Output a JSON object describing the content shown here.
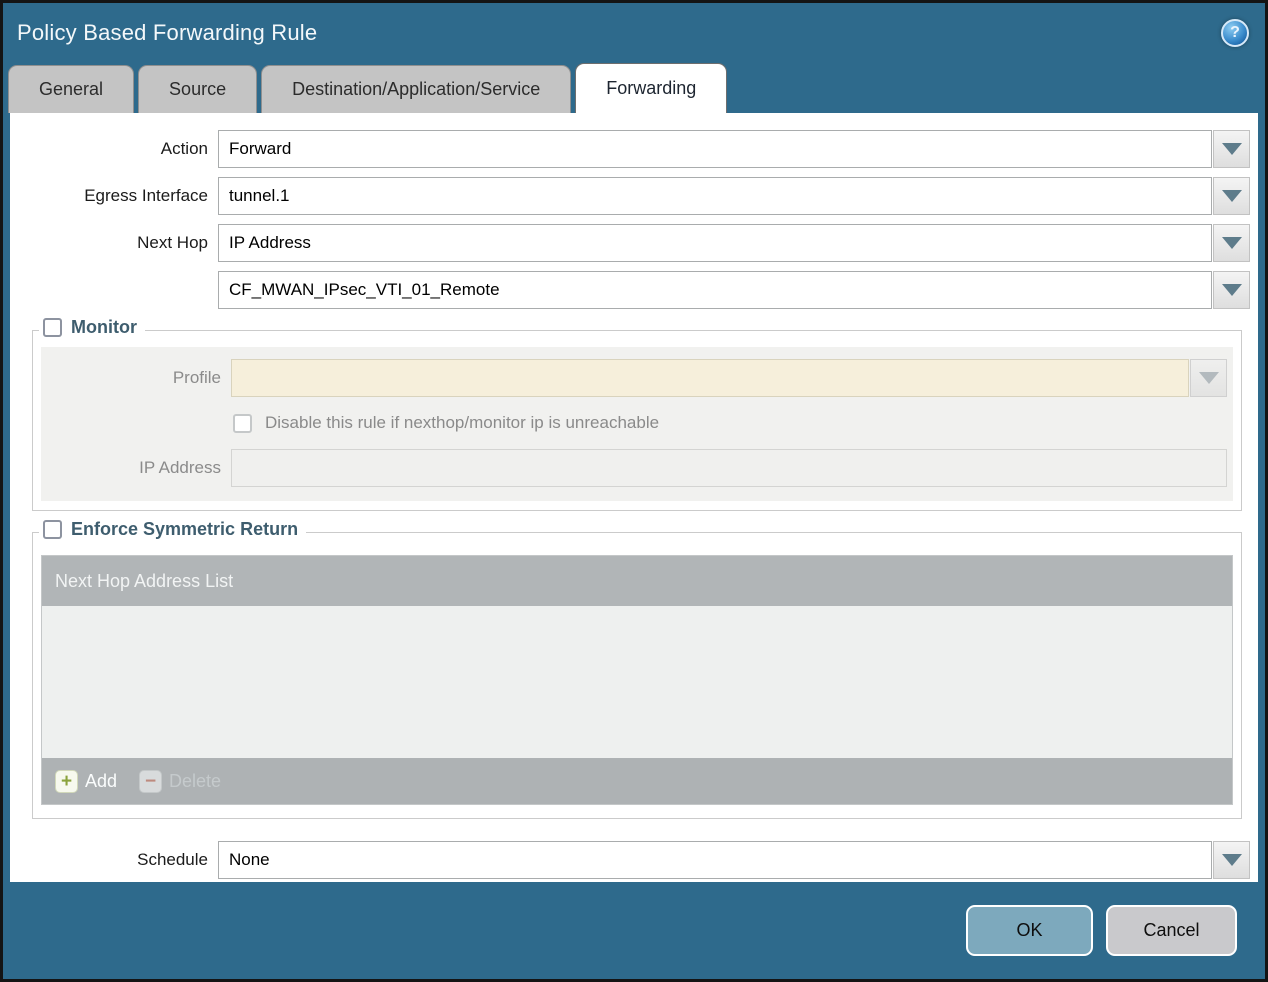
{
  "dialog": {
    "title": "Policy Based Forwarding Rule"
  },
  "icons": {
    "help": "?",
    "add": "+",
    "delete": "−"
  },
  "tabs": [
    {
      "label": "General",
      "active": false
    },
    {
      "label": "Source",
      "active": false
    },
    {
      "label": "Destination/Application/Service",
      "active": false
    },
    {
      "label": "Forwarding",
      "active": true
    }
  ],
  "form": {
    "action": {
      "label": "Action",
      "value": "Forward"
    },
    "egress_interface": {
      "label": "Egress Interface",
      "value": "tunnel.1"
    },
    "next_hop": {
      "label": "Next Hop",
      "value": "IP Address"
    },
    "next_hop_address": {
      "value": "CF_MWAN_IPsec_VTI_01_Remote"
    },
    "schedule": {
      "label": "Schedule",
      "value": "None"
    }
  },
  "monitor": {
    "title": "Monitor",
    "checked": false,
    "profile": {
      "label": "Profile",
      "value": ""
    },
    "disable_rule_checkbox": {
      "label": "Disable this rule if nexthop/monitor ip is unreachable",
      "checked": false
    },
    "ip_address": {
      "label": "IP Address",
      "value": ""
    }
  },
  "enforce_symmetric_return": {
    "title": "Enforce Symmetric Return",
    "checked": false,
    "table": {
      "header": "Next Hop Address List",
      "rows": []
    },
    "add_button": "Add",
    "delete_button": "Delete"
  },
  "footer": {
    "ok": "OK",
    "cancel": "Cancel"
  },
  "colors": {
    "titlebar_teal": "#2e6a8c",
    "tab_inactive": "#c4c4c4",
    "ok_button": "#7da9bd",
    "cancel_button": "#c9c9cc",
    "disabled_field_cream": "#f6efdb",
    "panel_gray": "#f1f1ef",
    "table_header_gray": "#b1b5b7"
  }
}
